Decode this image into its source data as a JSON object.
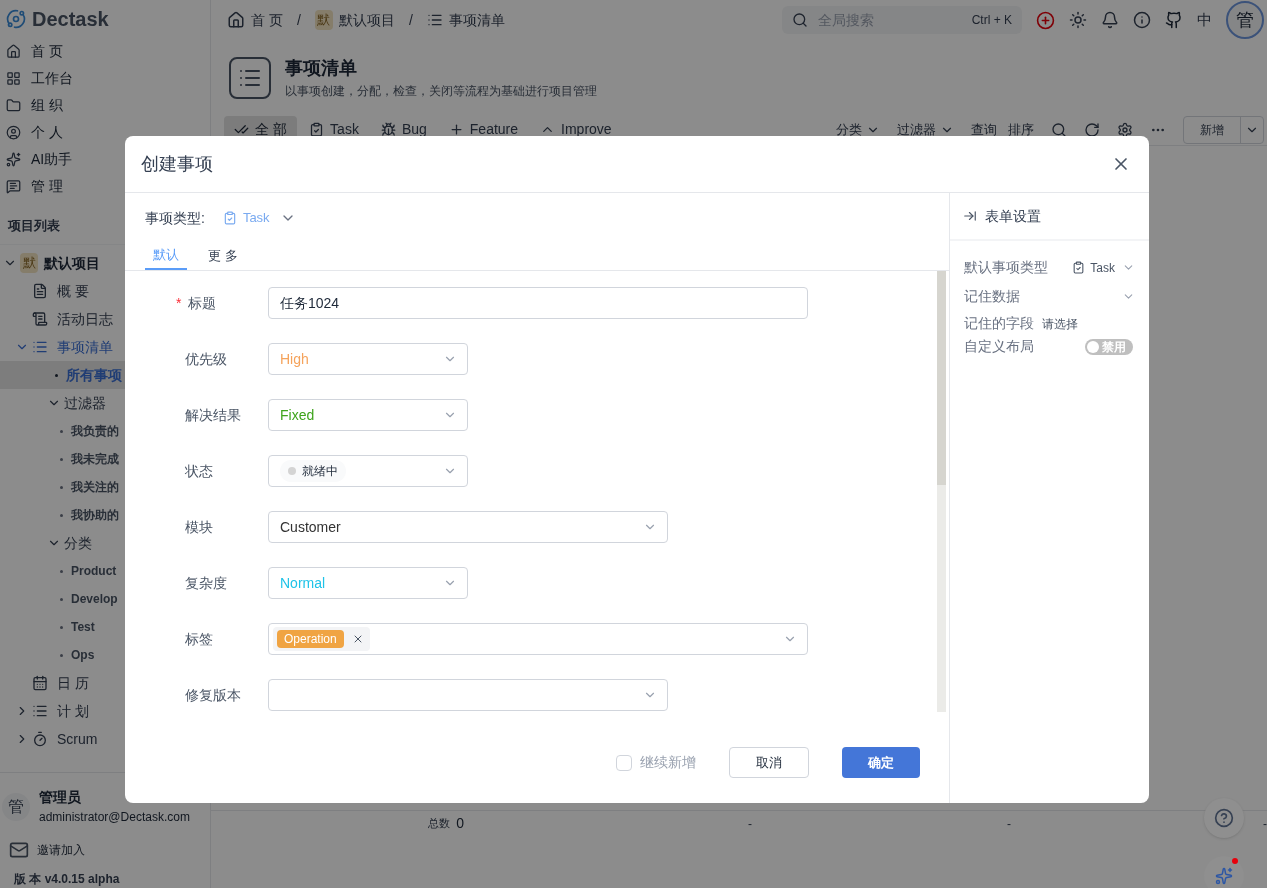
{
  "app": {
    "name": "Dectask"
  },
  "nav": [
    {
      "label": "首 页"
    },
    {
      "label": "工作台"
    },
    {
      "label": "组 织"
    },
    {
      "label": "个 人"
    },
    {
      "label": "AI助手"
    },
    {
      "label": "管 理"
    }
  ],
  "sidebar": {
    "section_title": "项目列表",
    "tree": [
      {
        "label": "默认项目",
        "badge": "默",
        "expanded": true,
        "selected": false,
        "children": [
          {
            "label": "概 要",
            "selected": false
          },
          {
            "label": "活动日志",
            "selected": false
          },
          {
            "label": "事项清单",
            "expanded": true,
            "selected": false,
            "children": [
              {
                "label": "所有事项",
                "selected": true
              },
              {
                "label": "过滤器",
                "expanded": true,
                "selected": false,
                "children": [
                  {
                    "label": "我负责的",
                    "selected": false
                  },
                  {
                    "label": "我未完成",
                    "selected": false
                  },
                  {
                    "label": "我关注的",
                    "selected": false
                  },
                  {
                    "label": "我协助的",
                    "selected": false
                  }
                ]
              },
              {
                "label": "分类",
                "expanded": true,
                "selected": false,
                "children": [
                  {
                    "label": "Product",
                    "selected": false
                  },
                  {
                    "label": "Develop",
                    "selected": false
                  },
                  {
                    "label": "Test",
                    "selected": false
                  },
                  {
                    "label": "Ops",
                    "selected": false
                  }
                ]
              }
            ]
          },
          {
            "label": "日 历",
            "selected": false
          },
          {
            "label": "计 划",
            "expanded": false,
            "selected": false
          },
          {
            "label": "Scrum",
            "expanded": false,
            "selected": false
          }
        ]
      }
    ]
  },
  "user": {
    "avatar": "管",
    "name": "管理员",
    "email": "administrator@Dectask.com"
  },
  "invite": "邀请加入",
  "version": "版 本 v4.0.15 alpha",
  "breadcrumb": [
    {
      "label": "首 页"
    },
    {
      "separator": "/",
      "label": "默认项目",
      "badge": "默"
    },
    {
      "separator": "/",
      "label": "事项清单"
    }
  ],
  "search": {
    "placeholder": "全局搜索",
    "shortcut": "Ctrl + K"
  },
  "topbar": {
    "language": "中",
    "avatar": "管"
  },
  "page": {
    "title": "事项清单",
    "subtitle": "以事项创建，分配，检查，关闭等流程为基础进行项目管理"
  },
  "type_tabs": [
    {
      "label": "全 部",
      "selected": true
    },
    {
      "label": "Task",
      "selected": false
    },
    {
      "label": "Bug",
      "selected": false
    },
    {
      "label": "Feature",
      "selected": false
    },
    {
      "label": "Improve",
      "selected": false
    }
  ],
  "toolbar": {
    "menus": [
      "分类",
      "过滤器"
    ],
    "links": [
      "查询",
      "排序"
    ],
    "new_button": "新增"
  },
  "table_footer": {
    "total_label": "总数",
    "total": "0",
    "cells": [
      "-",
      "-",
      "-"
    ]
  },
  "dialog": {
    "title": "创建事项",
    "required_mark": "*",
    "type_field": {
      "label": "事项类型:",
      "value": "Task"
    },
    "tabs": [
      {
        "label": "默认",
        "selected": true
      },
      {
        "label": "更 多",
        "selected": false
      }
    ],
    "fields": [
      {
        "label": "标题",
        "required": true,
        "kind": "text",
        "value": "任务1024"
      },
      {
        "label": "优先级",
        "required": false,
        "kind": "select",
        "value": "High",
        "color": "#f5a35c"
      },
      {
        "label": "解决结果",
        "required": false,
        "kind": "select",
        "value": "Fixed",
        "color": "#3fa41d"
      },
      {
        "label": "状态",
        "required": false,
        "kind": "status",
        "value": "就绪中",
        "color": "#d4d4d4"
      },
      {
        "label": "模块",
        "required": false,
        "kind": "wide-select",
        "value": "Customer",
        "color": "#333333"
      },
      {
        "label": "复杂度",
        "required": false,
        "kind": "select",
        "value": "Normal",
        "color": "#1fc3e8"
      },
      {
        "label": "标签",
        "required": false,
        "kind": "tags",
        "tags": [
          {
            "label": "Operation",
            "color": "#f0a443"
          }
        ]
      },
      {
        "label": "修复版本",
        "required": false,
        "kind": "wide-select"
      }
    ],
    "continue": {
      "label": "继续新增",
      "checked": false
    },
    "cancel": "取消",
    "confirm": "确定",
    "settings": {
      "title": "表单设置",
      "default_type": {
        "label": "默认事项类型",
        "value": "Task"
      },
      "remember": {
        "label": "记住数据"
      },
      "remember_fields": {
        "label": "记住的字段",
        "placeholder": "请选择"
      },
      "custom_layout": {
        "label": "自定义布局",
        "on": false,
        "text": "禁用"
      }
    }
  }
}
